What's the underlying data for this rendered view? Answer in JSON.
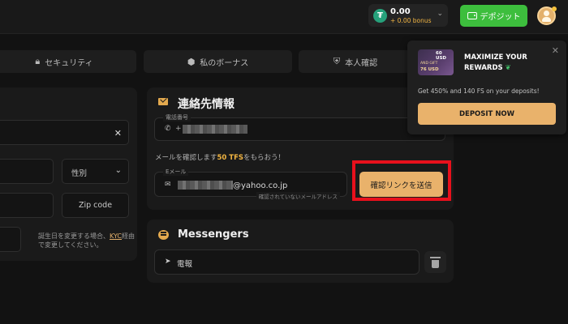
{
  "header": {
    "balance_amount": "0.00",
    "balance_bonus": "+ 0.00 bonus",
    "currency_icon": "tether-icon",
    "deposit_label": "デポジット"
  },
  "tabs": [
    {
      "label": "セキュリティ",
      "icon": "lock-icon"
    },
    {
      "label": "私のボーナス",
      "icon": "cube-icon"
    },
    {
      "label": "本人確認",
      "icon": "shield-check-icon"
    }
  ],
  "left_form": {
    "gender_label": "性別",
    "zip_label": "Zip code",
    "kyc_note_before": "誕生日を変更する場合、",
    "kyc_link": "KYC",
    "kyc_note_after": "経由で変更してください。"
  },
  "contact": {
    "title": "連絡先情報",
    "phone_label": "電話番号",
    "phone_prefix": "+",
    "promo_before": "メールを確認します",
    "promo_highlight": "50 TFS",
    "promo_after": "をもらおう！",
    "email_label": "Eメール",
    "email_suffix": "@yahoo.co.jp",
    "email_status": "確認されていないメールアドレス",
    "send_button": "確認リンクを送信"
  },
  "messengers": {
    "title": "Messengers",
    "telegram_label": "電報"
  },
  "popup": {
    "gift_amount": "60 USD",
    "gift_and": "AND GIFT",
    "gift_value": "76 USD",
    "title": "MAXIMIZE YOUR REWARDS",
    "description": "Get 450% and 140 FS on your deposits!",
    "button": "DEPOSIT NOW"
  },
  "colors": {
    "accent": "#e9b26b",
    "deposit_green": "#3dbe3d",
    "highlight_red": "#e8101c",
    "promo_yellow": "#f2b542"
  }
}
